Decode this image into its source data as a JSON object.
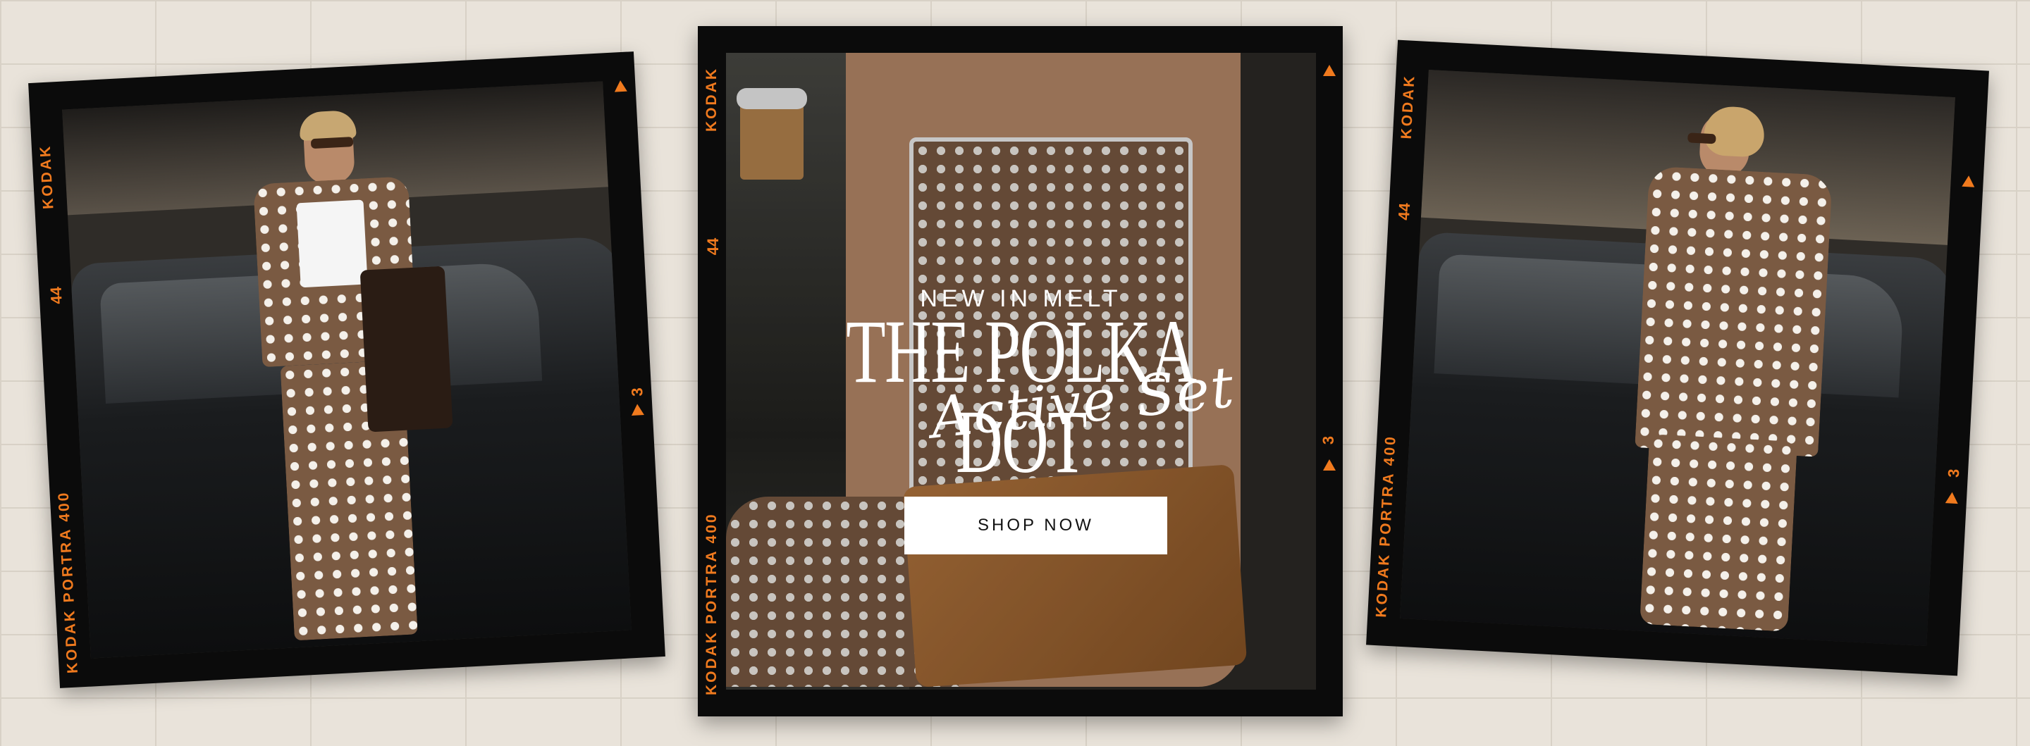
{
  "banner": {
    "eyebrow": "NEW IN MELT",
    "headline": "THE POLKA DOT",
    "script_text": "Active Set",
    "cta_label": "SHOP NOW"
  },
  "film": {
    "brand": "KODAK",
    "stock": "KODAK PORTRA 400",
    "frame_number_a": "44",
    "frame_number_b": "3",
    "accent_color": "#f07a1e"
  },
  "colors": {
    "background": "#e9e3da",
    "frame": "#0b0b0b",
    "polka_base": "#7a5a42",
    "polka_dot": "#f4f0ea"
  }
}
